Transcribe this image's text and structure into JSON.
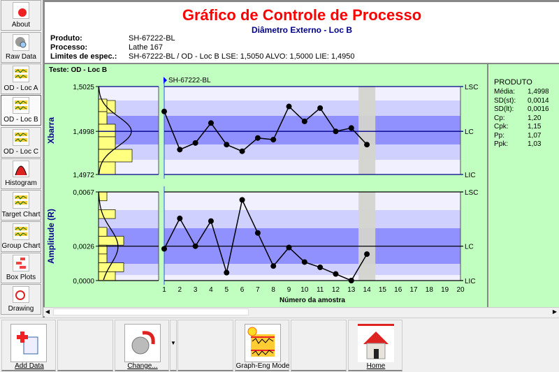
{
  "sidebar": {
    "items": [
      {
        "label": "About",
        "icon": "about-icon"
      },
      {
        "label": "Raw Data",
        "icon": "gear-search-icon"
      },
      {
        "label": "OD - Loc A",
        "icon": "control-chart-icon"
      },
      {
        "label": "OD - Loc B",
        "icon": "control-chart-icon",
        "selected": true
      },
      {
        "label": "OD - Loc C",
        "icon": "control-chart-icon"
      },
      {
        "label": "Histogram",
        "icon": "histogram-icon"
      },
      {
        "label": "Target Chart",
        "icon": "control-chart-icon"
      },
      {
        "label": "Group Chart",
        "icon": "control-chart-icon"
      },
      {
        "label": "Box Plots",
        "icon": "box-plot-icon"
      },
      {
        "label": "Drawing",
        "icon": "drawing-icon"
      }
    ]
  },
  "header": {
    "title": "Gráfico de Controle de Processo",
    "subtitle": "Diâmetro Externo - Loc B",
    "info": [
      {
        "key": "Produto:",
        "value": "SH-67222-BL"
      },
      {
        "key": "Processo:",
        "value": "Lathe 167"
      },
      {
        "key": "Limites de espec.:",
        "value": "SH-67222-BL / OD - Loc B LSE: 1,5050 ALVO: 1,5000 LIE: 1,4950"
      }
    ]
  },
  "panel": {
    "test_label": "Teste: OD - Loc B",
    "marker_label": "SH-67222-BL"
  },
  "stats": {
    "heading": "PRODUTO",
    "rows": [
      {
        "k": "Média:",
        "v": "1,4998"
      },
      {
        "k": "SD(st):",
        "v": "0,0014"
      },
      {
        "k": "SD(lt):",
        "v": "0,0016"
      },
      {
        "k": "Cp:",
        "v": "1,20"
      },
      {
        "k": "Cpk:",
        "v": "1,15"
      },
      {
        "k": "Pp:",
        "v": "1,07"
      },
      {
        "k": "Ppk:",
        "v": "1,03"
      }
    ]
  },
  "toolbar": {
    "add_data": "Add Data",
    "change": "Change...",
    "graph_eng": "Graph-Eng Mode",
    "home": "Home"
  },
  "chart_data": [
    {
      "type": "line",
      "ylabel": "Xbarra",
      "ylim": [
        1.4972,
        1.5025
      ],
      "yticks": [
        "1,5025",
        "1,4998",
        "1,4972"
      ],
      "limits": {
        "LSC": 1.5025,
        "LC": 1.4998,
        "LIC": 1.4972
      },
      "limit_labels": [
        "LSC",
        "LC",
        "LIC"
      ],
      "x": [
        1,
        2,
        3,
        4,
        5,
        6,
        7,
        8,
        9,
        10,
        11,
        12,
        13,
        14
      ],
      "values": [
        1.501,
        1.4987,
        1.4991,
        1.5003,
        1.499,
        1.4986,
        1.4994,
        1.4993,
        1.5013,
        1.5004,
        1.5012,
        1.4998,
        1.5,
        1.499
      ],
      "histogram_counts": [
        2,
        1,
        1,
        2,
        2,
        4,
        2
      ]
    },
    {
      "type": "line",
      "ylabel": "Amplitude (R)",
      "xlabel": "Número da amostra",
      "ylim": [
        0,
        0.0067
      ],
      "yticks": [
        "0,0067",
        "0,0026",
        "0,0000"
      ],
      "limits": {
        "LSC": 0.0067,
        "LC": 0.0026,
        "LIC": 0
      },
      "limit_labels": [
        "LSC",
        "LC",
        "LIC"
      ],
      "xticks": [
        "1",
        "2",
        "3",
        "4",
        "5",
        "6",
        "7",
        "8",
        "9",
        "10",
        "11",
        "12",
        "13",
        "14",
        "15",
        "16",
        "17",
        "18",
        "19",
        "20"
      ],
      "x": [
        1,
        2,
        3,
        4,
        5,
        6,
        7,
        8,
        9,
        10,
        11,
        12,
        13,
        14
      ],
      "values": [
        0.0024,
        0.0047,
        0.0026,
        0.0045,
        0.0006,
        0.0061,
        0.0036,
        0.0011,
        0.0025,
        0.0014,
        0.001,
        0.0005,
        0.0,
        0.002
      ],
      "histogram_counts": [
        1,
        0,
        2,
        0,
        1,
        3,
        1,
        1,
        3,
        2
      ]
    }
  ],
  "highlighted_sample": 14,
  "colors": {
    "panel": "#c0ffc0",
    "title": "#ff0000",
    "axis": "#00008b",
    "band_dark": "#9090ff",
    "band_mid": "#d0d0ff",
    "band_light": "#f0f0ff",
    "histogram": "#ffff80"
  }
}
